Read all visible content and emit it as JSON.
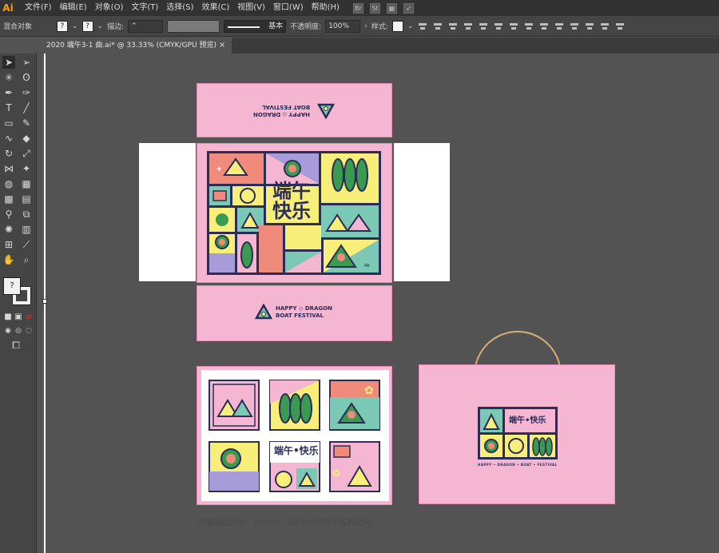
{
  "app": {
    "logo": "Ai"
  },
  "menu": [
    "文件(F)",
    "编辑(E)",
    "对象(O)",
    "文字(T)",
    "选择(S)",
    "效果(C)",
    "视图(V)",
    "窗口(W)",
    "帮助(H)"
  ],
  "menubar_icons": {
    "bridge": "Br",
    "stock": "St"
  },
  "control": {
    "mode_label": "混合对象",
    "fill_value": "?",
    "stroke_value": "?",
    "stroke_label": "描边:",
    "brush_name": "基本",
    "opacity_label": "不透明度:",
    "opacity_value": "100%",
    "style_label": "样式:"
  },
  "tab": {
    "title": "2020 端午3-1 曲.ai* @ 33.33% (CMYK/GPU 预览)",
    "close": "×"
  },
  "toolbox": {
    "fill_value": "?"
  },
  "artwork": {
    "lid_text_line1": "HAPPY ◇ DRAGON",
    "lid_text_line2": "BOAT FESTIVAL",
    "title_line1": "端午",
    "title_line2": "快乐",
    "small_title": "端午•快乐",
    "bag_footer": "HAPPY • DRAGON • BOAT • FESTIVAL",
    "caption": "内裱贴纸尺寸：9x9cm （请设计同尺寸结构文件）"
  },
  "colors": {
    "canvas": "#535353",
    "pink": "#f4b6d1",
    "navy": "#2b2d57",
    "yellow": "#f8ef7a",
    "teal": "#7bc8b5",
    "salmon": "#f08a7a",
    "green": "#3a9a52",
    "purple": "#a89bd9",
    "handle": "#d6b07a"
  }
}
